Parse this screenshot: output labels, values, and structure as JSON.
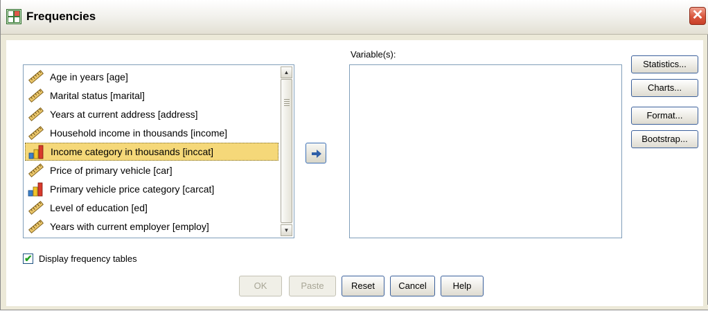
{
  "window": {
    "title": "Frequencies",
    "close_label": "✕"
  },
  "source_list": {
    "items": [
      {
        "label": "Age in years [age]",
        "icon": "scale-ruler-icon",
        "selected": false
      },
      {
        "label": "Marital status [marital]",
        "icon": "scale-ruler-icon",
        "selected": false
      },
      {
        "label": "Years at current address [address]",
        "icon": "scale-ruler-icon",
        "selected": false
      },
      {
        "label": "Household income in thousands [income]",
        "icon": "scale-ruler-icon",
        "selected": false
      },
      {
        "label": "Income category in thousands [inccat]",
        "icon": "ordinal-bar-icon",
        "selected": true
      },
      {
        "label": "Price of primary vehicle [car]",
        "icon": "scale-ruler-icon",
        "selected": false
      },
      {
        "label": "Primary vehicle price category [carcat]",
        "icon": "ordinal-bar-icon",
        "selected": false
      },
      {
        "label": "Level of education [ed]",
        "icon": "scale-ruler-icon",
        "selected": false
      },
      {
        "label": "Years with current employer [employ]",
        "icon": "scale-ruler-icon",
        "selected": false
      }
    ]
  },
  "target": {
    "label": "Variable(s):"
  },
  "side_buttons": {
    "statistics": "Statistics...",
    "charts": "Charts...",
    "format": "Format...",
    "bootstrap": "Bootstrap..."
  },
  "options": {
    "display_frequency_tables": "Display frequency tables",
    "display_frequency_tables_checked": true
  },
  "bottom_buttons": {
    "ok": "OK",
    "paste": "Paste",
    "reset": "Reset",
    "cancel": "Cancel",
    "help": "Help"
  },
  "colors": {
    "selection": "#f5d879",
    "button_border": "#3a5f9a",
    "close_button": "#d9573d"
  }
}
